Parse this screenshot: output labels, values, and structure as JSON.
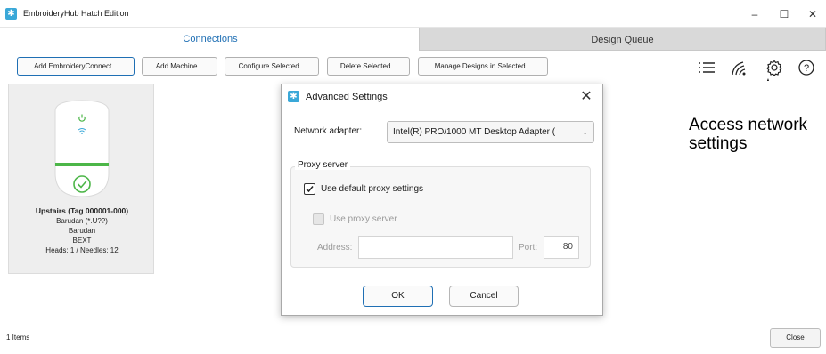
{
  "window": {
    "title": "EmbroideryHub Hatch Edition",
    "minimize": "–",
    "maximize": "☐",
    "close": "✕"
  },
  "tabs": [
    {
      "label": "Connections",
      "active": true
    },
    {
      "label": "Design Queue",
      "active": false
    }
  ],
  "toolbar": {
    "add_connect": "Add EmbroideryConnect...",
    "add_machine": "Add Machine...",
    "configure": "Configure Selected...",
    "delete": "Delete Selected...",
    "manage": "Manage Designs in Selected...",
    "icons": [
      "list-icon",
      "wireless-icon",
      "gear-icon",
      "help-icon"
    ]
  },
  "machine": {
    "name": "Upstairs (Tag 000001-000)",
    "line1": "Barudan (*.U??)",
    "line2": "Barudan",
    "line3": "BEXT",
    "line4": "Heads: 1 / Needles: 12",
    "accent_color": "#4cb648"
  },
  "annotation": {
    "line1": "Access network",
    "line2": "settings"
  },
  "dialog": {
    "title": "Advanced Settings",
    "close": "✕",
    "adapter_label": "Network adapter:",
    "adapter_value": "Intel(R) PRO/1000 MT Desktop Adapter (",
    "adapter_arrow": "⌄",
    "proxy_group": "Proxy server",
    "use_default": "Use default proxy settings",
    "use_default_checked": true,
    "use_proxy": "Use proxy server",
    "use_proxy_checked": false,
    "address_label": "Address:",
    "address_value": "",
    "port_label": "Port:",
    "port_value": "80",
    "ok": "OK",
    "cancel": "Cancel"
  },
  "status": {
    "items": "1 Items",
    "close": "Close"
  },
  "colors": {
    "accent": "#1f6fb4",
    "brand": "#3aa8d8",
    "status_green": "#4cb648"
  }
}
